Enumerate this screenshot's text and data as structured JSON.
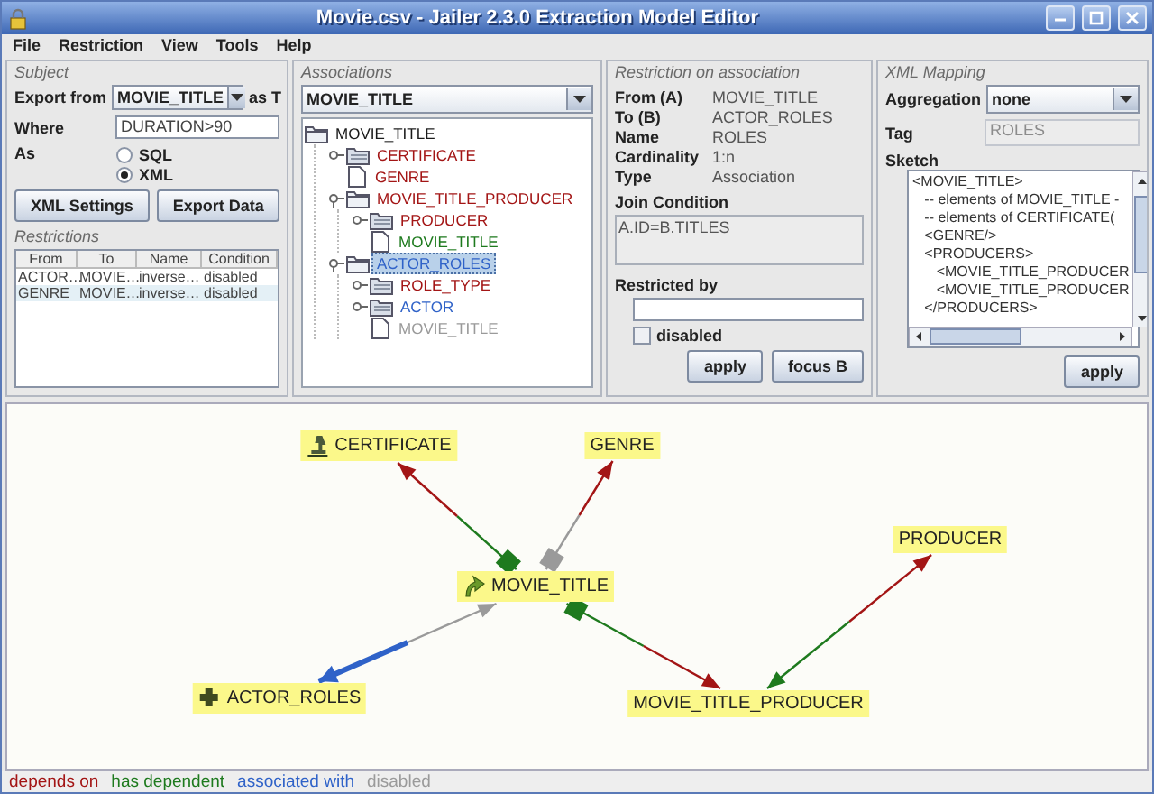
{
  "window": {
    "title": "Movie.csv - Jailer 2.3.0 Extraction Model Editor"
  },
  "menu": [
    "File",
    "Restriction",
    "View",
    "Tools",
    "Help"
  ],
  "subject": {
    "title": "Subject",
    "export_from_label": "Export from",
    "export_from": "MOVIE_TITLE",
    "as_t": "as T",
    "where_label": "Where",
    "where": "DURATION>90",
    "as_label": "As",
    "formats": [
      {
        "label": "SQL",
        "selected": false
      },
      {
        "label": "XML",
        "selected": true
      }
    ],
    "buttons": [
      "XML Settings",
      "Export Data"
    ]
  },
  "restrictions": {
    "title": "Restrictions",
    "columns": [
      "From",
      "To",
      "Name",
      "Condition"
    ],
    "rows": [
      {
        "cells": [
          "ACTOR…",
          "MOVIE…",
          "inverse…",
          "disabled"
        ],
        "selected": false
      },
      {
        "cells": [
          "GENRE",
          "MOVIE…",
          "inverse…",
          "disabled"
        ],
        "selected": true
      }
    ]
  },
  "associations": {
    "title": "Associations",
    "selector": "MOVIE_TITLE",
    "tree": {
      "label": "MOVIE_TITLE",
      "color": "#1a1a1a",
      "expanded": true,
      "selected": false,
      "children": [
        {
          "label": "CERTIFICATE",
          "color": "#a31515",
          "expanded": false,
          "selected": false
        },
        {
          "label": "GENRE",
          "color": "#a31515",
          "selected": false
        },
        {
          "label": "MOVIE_TITLE_PRODUCER",
          "color": "#a31515",
          "expanded": true,
          "selected": false,
          "children": [
            {
              "label": "PRODUCER",
              "color": "#a31515",
              "expanded": false,
              "selected": false
            },
            {
              "label": "MOVIE_TITLE",
              "color": "#1e7a1e",
              "selected": false
            }
          ]
        },
        {
          "label": "ACTOR_ROLES",
          "color": "#2f62c8",
          "expanded": true,
          "selected": true,
          "children": [
            {
              "label": "ROLE_TYPE",
              "color": "#a31515",
              "expanded": false,
              "selected": false
            },
            {
              "label": "ACTOR",
              "color": "#2f62c8",
              "expanded": false,
              "selected": false
            },
            {
              "label": "MOVIE_TITLE",
              "color": "#9a9a9a",
              "selected": false
            }
          ]
        }
      ]
    }
  },
  "restriction": {
    "title": "Restriction on association",
    "fields": [
      {
        "label": "From (A)",
        "value": "MOVIE_TITLE"
      },
      {
        "label": "To (B)",
        "value": "ACTOR_ROLES"
      },
      {
        "label": "Name",
        "value": "ROLES"
      },
      {
        "label": "Cardinality",
        "value": "1:n"
      },
      {
        "label": "Type",
        "value": "Association"
      }
    ],
    "join_label": "Join Condition",
    "join": "A.ID=B.TITLES",
    "restricted_by_label": "Restricted by",
    "disabled": {
      "label": "disabled",
      "checked": false
    },
    "buttons": [
      "apply",
      "focus B"
    ]
  },
  "xml_mapping": {
    "title": "XML Mapping",
    "aggregation_label": "Aggregation",
    "aggregation": "none",
    "tag_label": "Tag",
    "tag": {
      "value": "ROLES",
      "disabled": true
    },
    "sketch_label": "Sketch",
    "sketch_lines": [
      "<MOVIE_TITLE>",
      "   -- elements of MOVIE_TITLE -",
      "   -- elements of CERTIFICATE(",
      "   <GENRE/>",
      "   <PRODUCERS>",
      "      <MOVIE_TITLE_PRODUCER",
      "      <MOVIE_TITLE_PRODUCER",
      "   </PRODUCERS>"
    ],
    "button": "apply"
  },
  "graph": {
    "nodes": [
      {
        "label": "CERTIFICATE",
        "kind": "excluded"
      },
      {
        "label": "GENRE",
        "kind": "plain"
      },
      {
        "label": "MOVIE_TITLE",
        "kind": "subject"
      },
      {
        "label": "PRODUCER",
        "kind": "plain"
      },
      {
        "label": "ACTOR_ROLES",
        "kind": "expandable"
      },
      {
        "label": "MOVIE_TITLE_PRODUCER",
        "kind": "plain"
      }
    ],
    "edges": [
      {
        "kind": "dependency"
      },
      {
        "kind": "disabled"
      },
      {
        "kind": "association"
      },
      {
        "kind": "dependency"
      },
      {
        "kind": "mutual"
      }
    ]
  },
  "legend": [
    {
      "label": "depends on",
      "kind": "depends_on"
    },
    {
      "label": "has dependent",
      "kind": "has_dependent"
    },
    {
      "label": "associated with",
      "kind": "associated"
    },
    {
      "label": "disabled",
      "kind": "disabled"
    }
  ]
}
